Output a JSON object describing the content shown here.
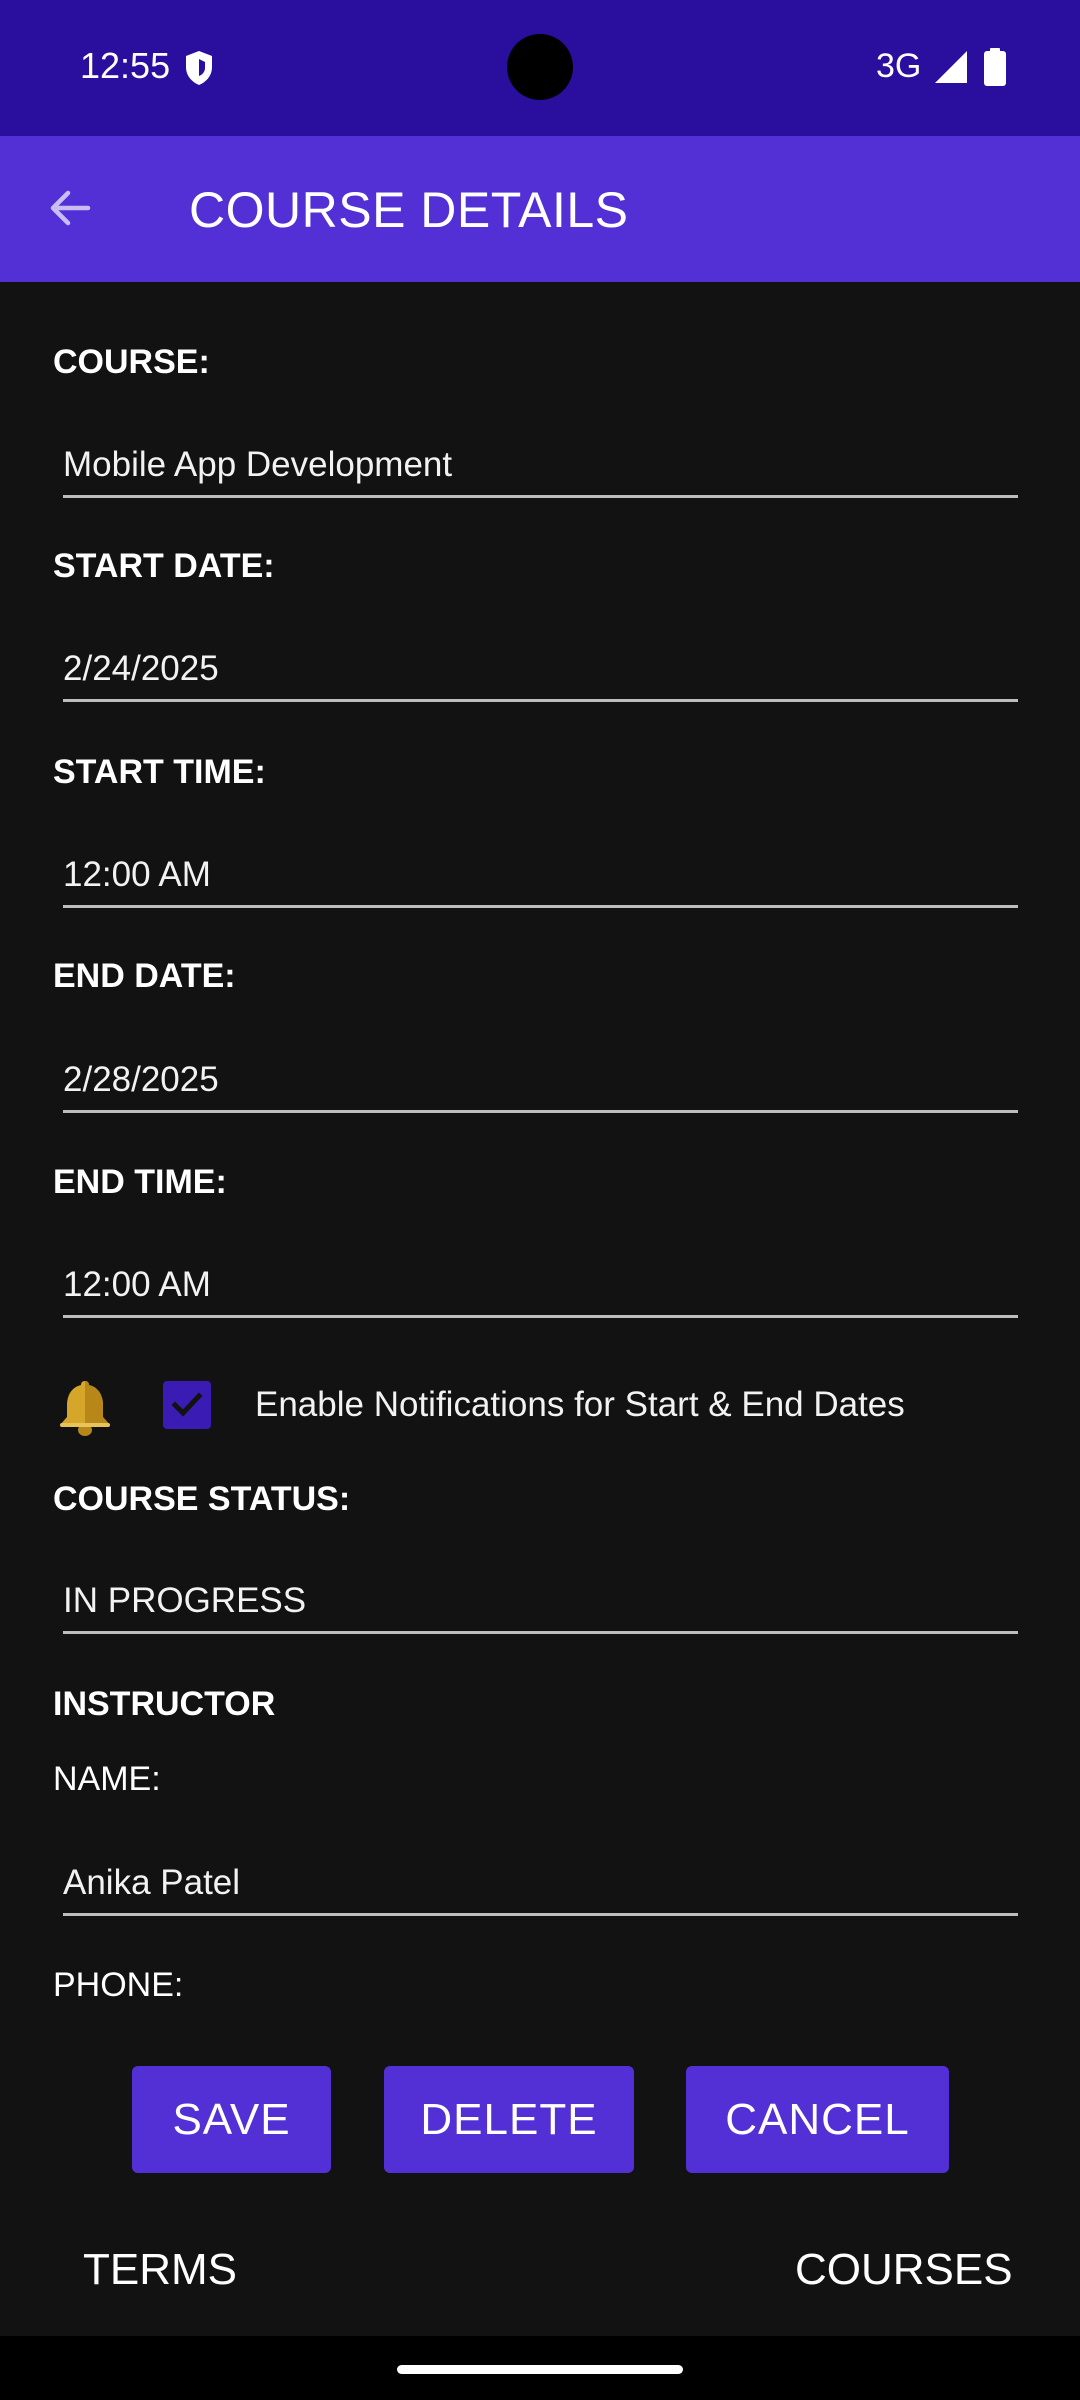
{
  "status_bar": {
    "time": "12:55",
    "network": "3G"
  },
  "app_bar": {
    "title": "COURSE DETAILS"
  },
  "form": {
    "course_label": "COURSE:",
    "course_value": "Mobile App Development",
    "start_date_label": "START DATE:",
    "start_date_value": "2/24/2025",
    "start_time_label": "START TIME:",
    "start_time_value": "12:00 AM",
    "end_date_label": "END DATE:",
    "end_date_value": "2/28/2025",
    "end_time_label": "END TIME:",
    "end_time_value": "12:00 AM",
    "notifications_label": "Enable Notifications for Start & End Dates",
    "notifications_checked": true,
    "status_label": "COURSE STATUS:",
    "status_value": "IN PROGRESS",
    "instructor_heading": "INSTRUCTOR",
    "name_label": "NAME:",
    "name_value": "Anika Patel",
    "phone_label": "PHONE:"
  },
  "actions": {
    "save": "SAVE",
    "delete": "DELETE",
    "cancel": "CANCEL"
  },
  "footer": {
    "terms": "TERMS",
    "courses": "COURSES"
  },
  "colors": {
    "status_bar": "#2a0e9e",
    "app_bar": "#5330d6",
    "background": "#121212",
    "button": "#5330d6"
  },
  "icons": {
    "back": "arrow-left-icon",
    "bell": "bell-icon",
    "check": "check-icon",
    "shield": "shield-icon",
    "signal": "signal-icon",
    "battery": "battery-icon"
  }
}
